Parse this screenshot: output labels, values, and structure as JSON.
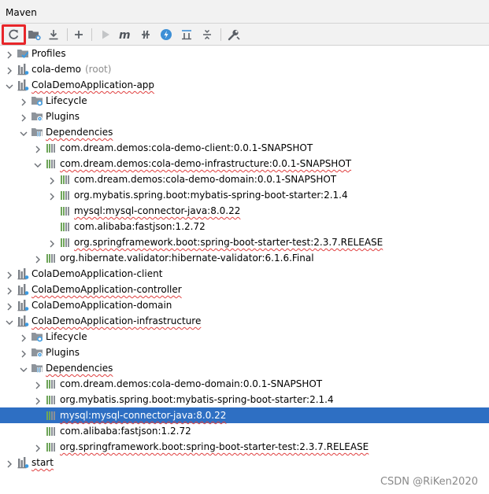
{
  "window": {
    "title": "Maven"
  },
  "toolbar": {
    "buttons": [
      {
        "name": "reload-all-maven-projects-button",
        "icon": "refresh-icon"
      },
      {
        "name": "generate-sources-button",
        "icon": "folder-gear-icon"
      },
      {
        "name": "download-sources-button",
        "icon": "download-icon"
      },
      {
        "name": "add-maven-project-button",
        "icon": "plus-icon"
      },
      {
        "name": "run-maven-build-button",
        "icon": "play-icon"
      },
      {
        "name": "execute-maven-goal-button",
        "icon": "m-icon"
      },
      {
        "name": "toggle-offline-mode-button",
        "icon": "offline-icon"
      },
      {
        "name": "toggle-skip-tests-button",
        "icon": "lightning-icon"
      },
      {
        "name": "show-dependencies-button",
        "icon": "dependencies-icon"
      },
      {
        "name": "collapse-all-button",
        "icon": "collapse-icon"
      },
      {
        "name": "maven-settings-button",
        "icon": "wrench-icon"
      }
    ]
  },
  "tree": [
    {
      "label": "Profiles",
      "suffix": "",
      "icon": "profiles-icon",
      "level": 0,
      "arrow": "right",
      "squig": false,
      "selected": false
    },
    {
      "label": "cola-demo",
      "suffix": "(root)",
      "icon": "maven-module-icon",
      "level": 0,
      "arrow": "right",
      "squig": false,
      "selected": false
    },
    {
      "label": "ColaDemoApplication-app",
      "suffix": "",
      "icon": "maven-module-icon",
      "level": 0,
      "arrow": "down",
      "squig": true,
      "selected": false
    },
    {
      "label": "Lifecycle",
      "suffix": "",
      "icon": "lifecycle-folder-icon",
      "level": 1,
      "arrow": "right",
      "squig": false,
      "selected": false
    },
    {
      "label": "Plugins",
      "suffix": "",
      "icon": "plugins-folder-icon",
      "level": 1,
      "arrow": "right",
      "squig": false,
      "selected": false
    },
    {
      "label": "Dependencies",
      "suffix": "",
      "icon": "dependencies-folder-icon",
      "level": 1,
      "arrow": "down",
      "squig": true,
      "selected": false
    },
    {
      "label": "com.dream.demos:cola-demo-client:0.0.1-SNAPSHOT",
      "suffix": "",
      "icon": "library-icon",
      "level": 2,
      "arrow": "right",
      "squig": false,
      "selected": false
    },
    {
      "label": "com.dream.demos:cola-demo-infrastructure:0.0.1-SNAPSHOT",
      "suffix": "",
      "icon": "library-icon",
      "level": 2,
      "arrow": "down",
      "squig": true,
      "selected": false
    },
    {
      "label": "com.dream.demos:cola-demo-domain:0.0.1-SNAPSHOT",
      "suffix": "",
      "icon": "library-icon",
      "level": 3,
      "arrow": "right",
      "squig": false,
      "selected": false
    },
    {
      "label": "org.mybatis.spring.boot:mybatis-spring-boot-starter:2.1.4",
      "suffix": "",
      "icon": "library-icon",
      "level": 3,
      "arrow": "right",
      "squig": false,
      "selected": false
    },
    {
      "label": "mysql:mysql-connector-java:8.0.22",
      "suffix": "",
      "icon": "library-icon",
      "level": 3,
      "arrow": "none",
      "squig": true,
      "selected": false
    },
    {
      "label": "com.alibaba:fastjson:1.2.72",
      "suffix": "",
      "icon": "library-icon",
      "level": 3,
      "arrow": "none",
      "squig": false,
      "selected": false
    },
    {
      "label": "org.springframework.boot:spring-boot-starter-test:2.3.7.RELEASE",
      "suffix": "",
      "icon": "library-icon",
      "level": 3,
      "arrow": "right",
      "squig": true,
      "selected": false
    },
    {
      "label": "org.hibernate.validator:hibernate-validator:6.1.6.Final",
      "suffix": "",
      "icon": "library-icon",
      "level": 2,
      "arrow": "right",
      "squig": false,
      "selected": false
    },
    {
      "label": "ColaDemoApplication-client",
      "suffix": "",
      "icon": "maven-module-icon",
      "level": 0,
      "arrow": "right",
      "squig": false,
      "selected": false
    },
    {
      "label": "ColaDemoApplication-controller",
      "suffix": "",
      "icon": "maven-module-icon",
      "level": 0,
      "arrow": "right",
      "squig": true,
      "selected": false
    },
    {
      "label": "ColaDemoApplication-domain",
      "suffix": "",
      "icon": "maven-module-icon",
      "level": 0,
      "arrow": "right",
      "squig": false,
      "selected": false
    },
    {
      "label": "ColaDemoApplication-infrastructure",
      "suffix": "",
      "icon": "maven-module-icon",
      "level": 0,
      "arrow": "down",
      "squig": true,
      "selected": false
    },
    {
      "label": "Lifecycle",
      "suffix": "",
      "icon": "lifecycle-folder-icon",
      "level": 1,
      "arrow": "right",
      "squig": false,
      "selected": false
    },
    {
      "label": "Plugins",
      "suffix": "",
      "icon": "plugins-folder-icon",
      "level": 1,
      "arrow": "right",
      "squig": false,
      "selected": false
    },
    {
      "label": "Dependencies",
      "suffix": "",
      "icon": "dependencies-folder-icon",
      "level": 1,
      "arrow": "down",
      "squig": true,
      "selected": false
    },
    {
      "label": "com.dream.demos:cola-demo-domain:0.0.1-SNAPSHOT",
      "suffix": "",
      "icon": "library-icon",
      "level": 2,
      "arrow": "right",
      "squig": false,
      "selected": false
    },
    {
      "label": "org.mybatis.spring.boot:mybatis-spring-boot-starter:2.1.4",
      "suffix": "",
      "icon": "library-icon",
      "level": 2,
      "arrow": "right",
      "squig": false,
      "selected": false
    },
    {
      "label": "mysql:mysql-connector-java:8.0.22",
      "suffix": "",
      "icon": "library-icon",
      "level": 2,
      "arrow": "none",
      "squig": true,
      "selected": true
    },
    {
      "label": "com.alibaba:fastjson:1.2.72",
      "suffix": "",
      "icon": "library-icon",
      "level": 2,
      "arrow": "none",
      "squig": false,
      "selected": false
    },
    {
      "label": "org.springframework.boot:spring-boot-starter-test:2.3.7.RELEASE",
      "suffix": "",
      "icon": "library-icon",
      "level": 2,
      "arrow": "right",
      "squig": true,
      "selected": false
    },
    {
      "label": "start",
      "suffix": "",
      "icon": "maven-module-icon",
      "level": 0,
      "arrow": "right",
      "squig": true,
      "selected": false
    }
  ],
  "watermark": "CSDN @RiKen2020",
  "colors": {
    "selection": "#2e6fc3",
    "highlight_box": "#e8262a",
    "squiggle": "#e04040",
    "tool_window_bg": "#f2f2f2"
  }
}
